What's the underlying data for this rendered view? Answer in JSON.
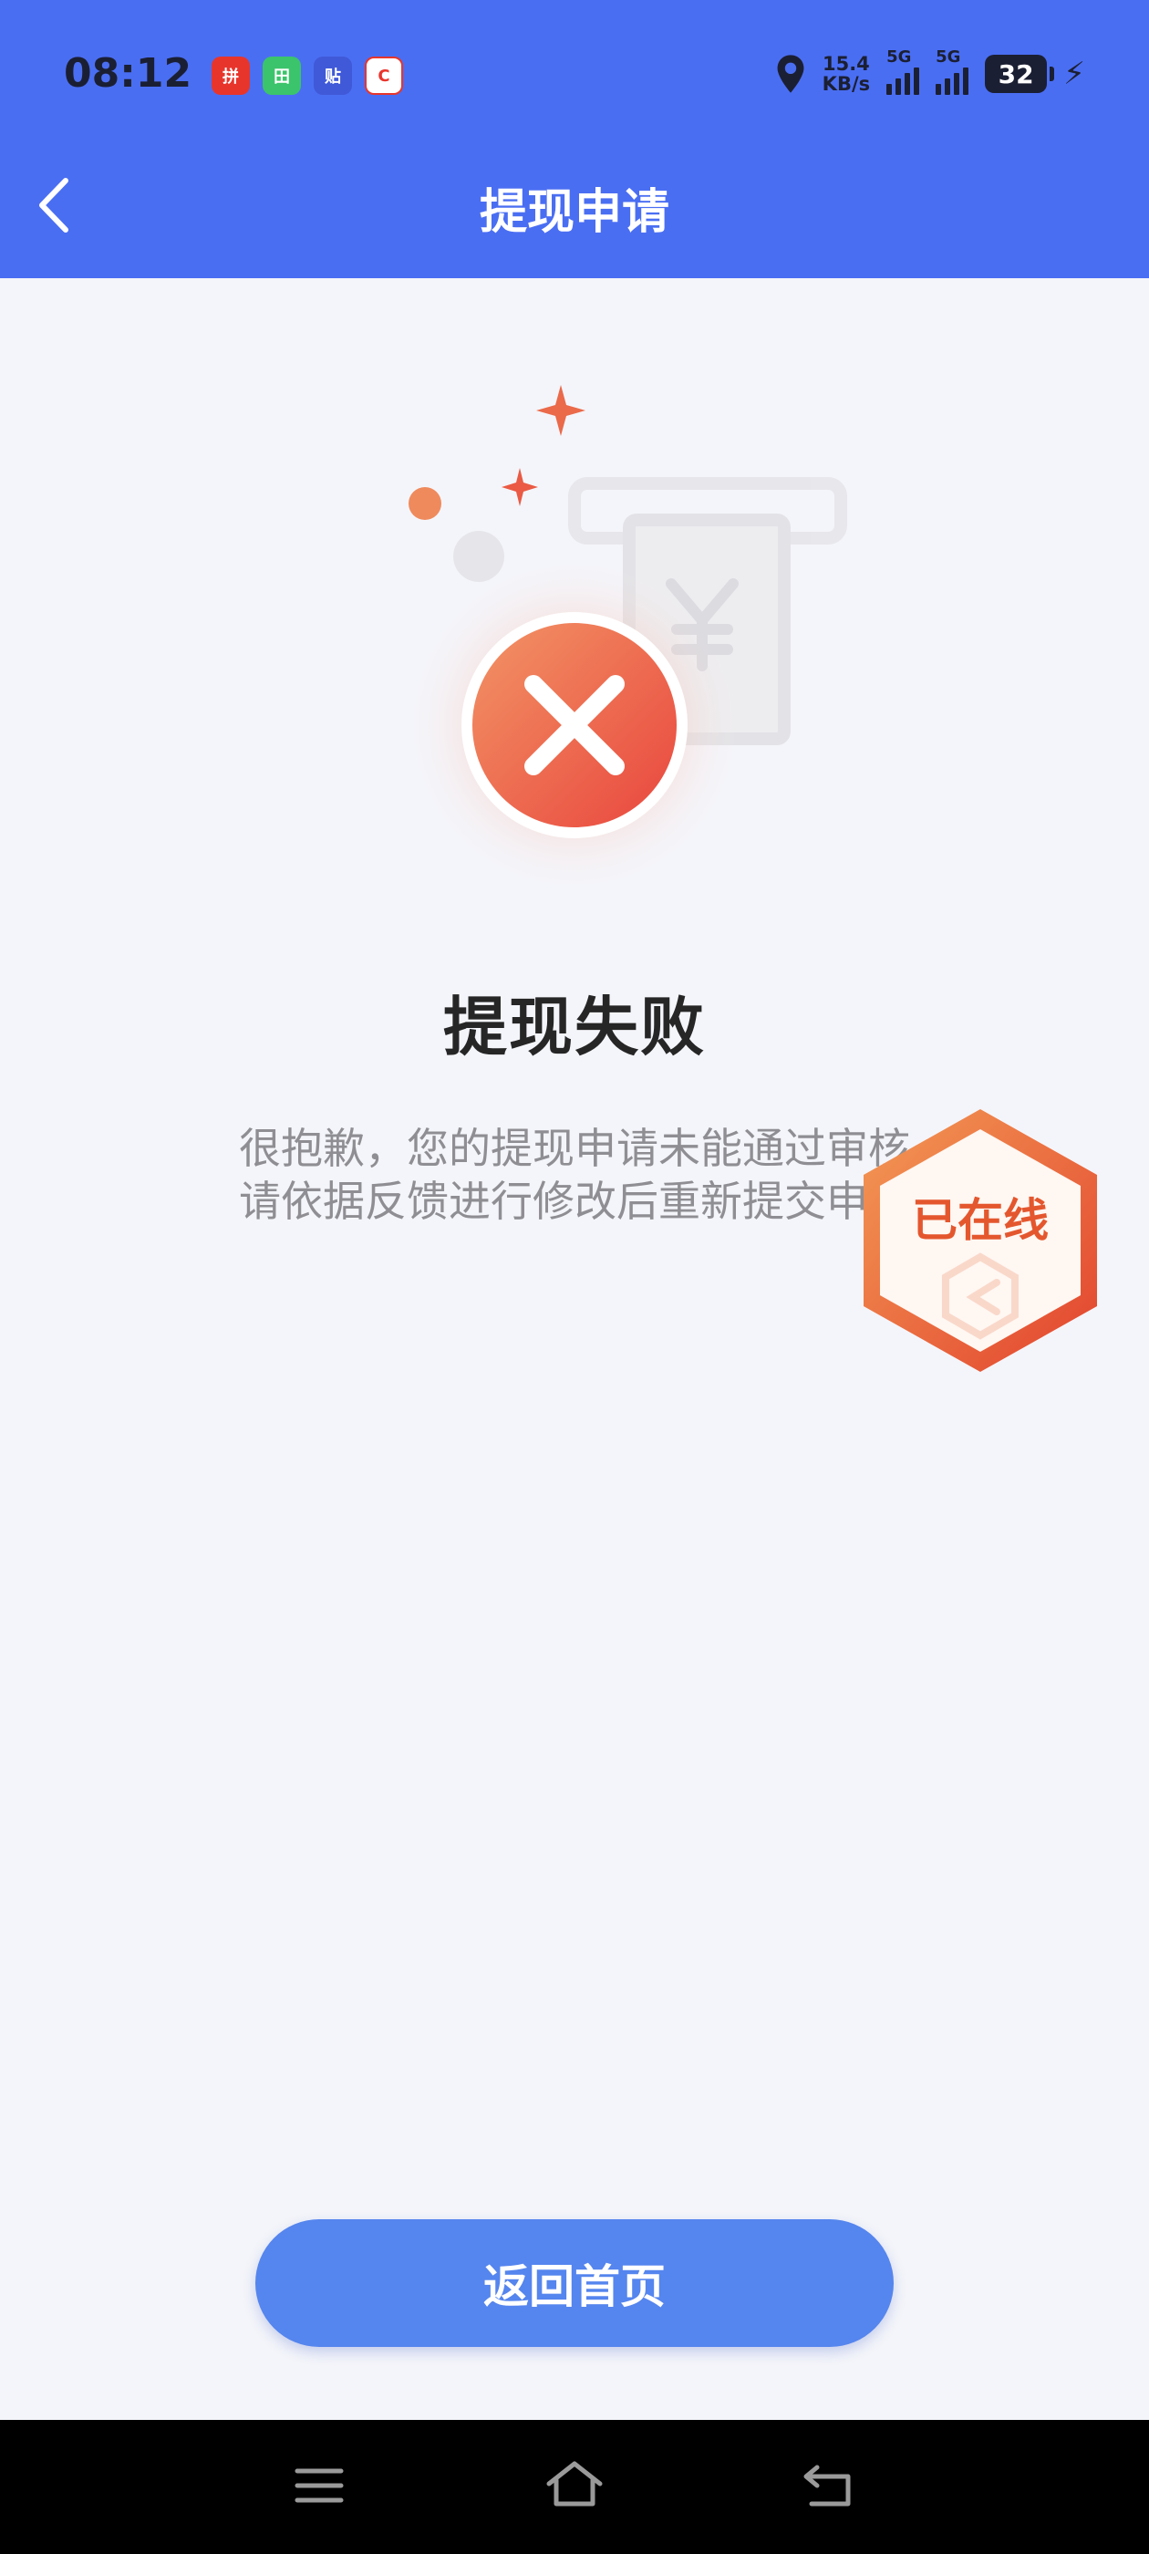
{
  "status_bar": {
    "time": "08:12",
    "net_speed_value": "15.4",
    "net_speed_unit": "KB/s",
    "sim1_label": "5G",
    "sim2_label": "5G",
    "battery": "32",
    "app_icons": [
      "pinduoduo-icon",
      "app-green-icon",
      "tieba-icon",
      "app-red-icon"
    ]
  },
  "header": {
    "title": "提现申请",
    "back_icon": "chevron-left-icon"
  },
  "result": {
    "title": "提现失败",
    "description_line1": "很抱歉，您的提现申请未能通过审核",
    "description_line2": "请依据反馈进行修改后重新提交申请",
    "icon": "error-x-icon"
  },
  "floating_badge": {
    "label": "已在线"
  },
  "actions": {
    "home_button": "返回首页"
  },
  "system_nav": {
    "menu_icon": "menu-icon",
    "home_icon": "home-icon",
    "back_icon": "back-icon"
  },
  "colors": {
    "primary": "#4a6ef2",
    "button": "#5585ee",
    "error": "#ee5a3f",
    "background": "#f4f5fa"
  }
}
